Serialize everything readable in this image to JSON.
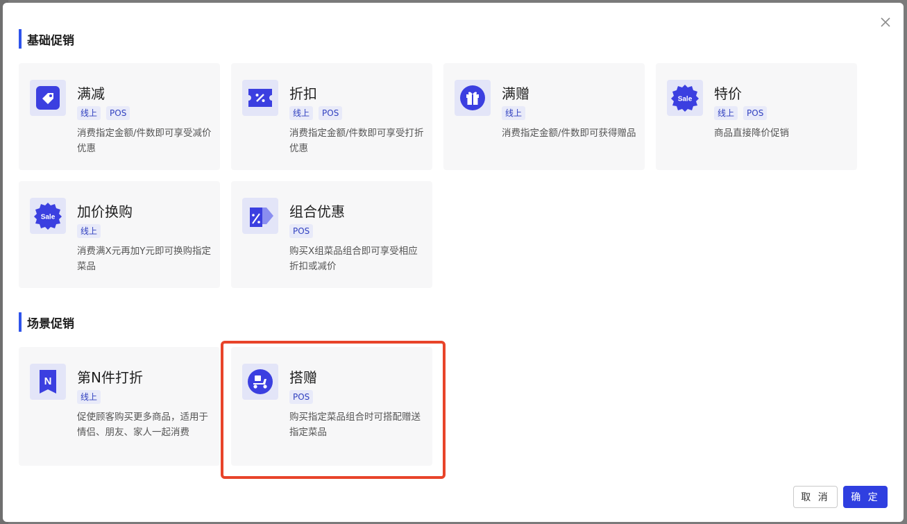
{
  "dialog": {
    "cancel_label": "取 消",
    "confirm_label": "确 定"
  },
  "sections": {
    "basic": {
      "title": "基础促销"
    },
    "scene": {
      "title": "场景促销"
    }
  },
  "cards": {
    "full_reduction": {
      "title": "满减",
      "tags": [
        "线上",
        "POS"
      ],
      "desc": "消费指定金额/件数即可享受减价优惠",
      "icon": "tag-icon"
    },
    "discount": {
      "title": "折扣",
      "tags": [
        "线上",
        "POS"
      ],
      "desc": "消费指定金额/件数即可享受打折优惠",
      "icon": "percent-coupon-icon"
    },
    "full_gift": {
      "title": "满赠",
      "tags": [
        "线上"
      ],
      "desc": "消费指定金额/件数即可获得赠品",
      "icon": "gift-icon"
    },
    "special_price": {
      "title": "特价",
      "tags": [
        "线上",
        "POS"
      ],
      "desc": "商品直接降价促销",
      "icon": "sale-badge-icon",
      "icon_text": "Sale"
    },
    "add_price_buy": {
      "title": "加价换购",
      "tags": [
        "线上"
      ],
      "desc": "消费满X元再加Y元即可换购指定菜品",
      "icon": "sale-badge-icon",
      "icon_text": "Sale"
    },
    "combo": {
      "title": "组合优惠",
      "tags": [
        "POS"
      ],
      "desc": "购买X组菜品组合即可享受相应折扣或减价",
      "icon": "percent-price-tag-icon"
    },
    "nth_item": {
      "title": "第N件打折",
      "tags": [
        "线上"
      ],
      "desc": "促使顾客购买更多商品，适用于情侣、朋友、家人一起消费",
      "icon": "n-bookmark-icon",
      "icon_text": "N"
    },
    "bundle_gift": {
      "title": "搭赠",
      "tags": [
        "POS"
      ],
      "desc": "购买指定菜品组合时可搭配赠送指定菜品",
      "icon": "scooter-icon"
    }
  },
  "colors": {
    "accent": "#2f3fe0",
    "section_bar": "#2f54eb",
    "highlight": "#e8442a"
  }
}
